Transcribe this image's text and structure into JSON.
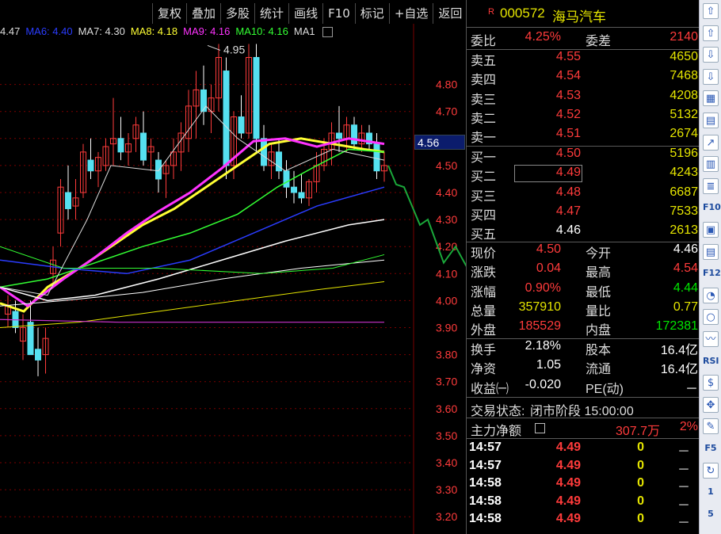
{
  "toolbar": [
    "复权",
    "叠加",
    "多股",
    "统计",
    "画线",
    "F10",
    "标记",
    "+自选",
    "返回"
  ],
  "ma": [
    {
      "label": "4.47",
      "color": "#dddddd"
    },
    {
      "label": "MA6: 4.40",
      "color": "#2a3cff"
    },
    {
      "label": "MA7: 4.30",
      "color": "#dddddd"
    },
    {
      "label": "MA8: 4.18",
      "color": "#ffff33"
    },
    {
      "label": "MA9: 4.16",
      "color": "#ff33ff"
    },
    {
      "label": "MA10: 4.16",
      "color": "#33ff33"
    },
    {
      "label": "MA1",
      "color": "#dddddd"
    }
  ],
  "high_label": "4.95",
  "price_tag": "4.56",
  "axis": [
    "4.80",
    "4.70",
    "4.60",
    "4.50",
    "4.40",
    "4.30",
    "4.20",
    "4.10",
    "4.00",
    "3.90",
    "3.80",
    "3.70",
    "3.60",
    "3.50",
    "3.40",
    "3.30",
    "3.20"
  ],
  "title": {
    "badge": "R",
    "code": "000572",
    "name": "海马汽车"
  },
  "weibi": {
    "label": "委比",
    "value": "4.25%",
    "label2": "委差",
    "value2": "2140"
  },
  "sell": [
    {
      "label": "卖五",
      "price": "4.55",
      "qty": "4650"
    },
    {
      "label": "卖四",
      "price": "4.54",
      "qty": "7468"
    },
    {
      "label": "卖三",
      "price": "4.53",
      "qty": "4208"
    },
    {
      "label": "卖二",
      "price": "4.52",
      "qty": "5132"
    },
    {
      "label": "卖一",
      "price": "4.51",
      "qty": "2674"
    }
  ],
  "buy": [
    {
      "label": "买一",
      "price": "4.50",
      "qty": "5196"
    },
    {
      "label": "买二",
      "price": "4.49",
      "qty": "4243"
    },
    {
      "label": "买三",
      "price": "4.48",
      "qty": "6687"
    },
    {
      "label": "买四",
      "price": "4.47",
      "qty": "7533"
    },
    {
      "label": "买五",
      "price": "4.46",
      "qty": "2613"
    }
  ],
  "stats": [
    {
      "l": "现价",
      "v": "4.50",
      "l2": "今开",
      "v2": "4.46"
    },
    {
      "l": "涨跌",
      "v": "0.04",
      "l2": "最高",
      "v2": "4.54"
    },
    {
      "l": "涨幅",
      "v": "0.90%",
      "l2": "最低",
      "v2": "4.44"
    },
    {
      "l": "总量",
      "v": "357910",
      "l2": "量比",
      "v2": "0.77"
    },
    {
      "l": "外盘",
      "v": "185529",
      "l2": "内盘",
      "v2": "172381"
    }
  ],
  "stats2": [
    {
      "l": "换手",
      "v": "2.18%",
      "l2": "股本",
      "v2": "16.4亿"
    },
    {
      "l": "净资",
      "v": "1.05",
      "l2": "流通",
      "v2": "16.4亿"
    },
    {
      "l": "收益㈠",
      "v": "-0.020",
      "l2": "PE(动)",
      "v2": "－"
    }
  ],
  "status": {
    "label": "交易状态:",
    "value": "闭市阶段 15:00:00"
  },
  "flow": {
    "label": "主力净额",
    "amount": "307.7万",
    "pct": "2%"
  },
  "trades": [
    {
      "t": "14:57",
      "p": "4.49",
      "v": "0",
      "f": "－"
    },
    {
      "t": "14:57",
      "p": "4.49",
      "v": "0",
      "f": "－"
    },
    {
      "t": "14:58",
      "p": "4.49",
      "v": "0",
      "f": "－"
    },
    {
      "t": "14:58",
      "p": "4.49",
      "v": "0",
      "f": "－"
    },
    {
      "t": "14:58",
      "p": "4.49",
      "v": "0",
      "f": "－"
    }
  ],
  "sidebar": [
    "up-arrow-icon",
    "up-outline-icon",
    "down-outline-icon",
    "down-arrow-icon",
    "grid-icon",
    "table-icon",
    "line-chart-icon",
    "bar-chart-icon",
    "list-icon",
    "F10",
    "calendar-icon",
    "doc-icon",
    "F12",
    "clock-icon",
    "circle-icon",
    "wave-icon",
    "RSI",
    "dollar-icon",
    "move-icon",
    "pen-icon",
    "F5",
    "refresh-icon",
    "1",
    "5"
  ]
}
